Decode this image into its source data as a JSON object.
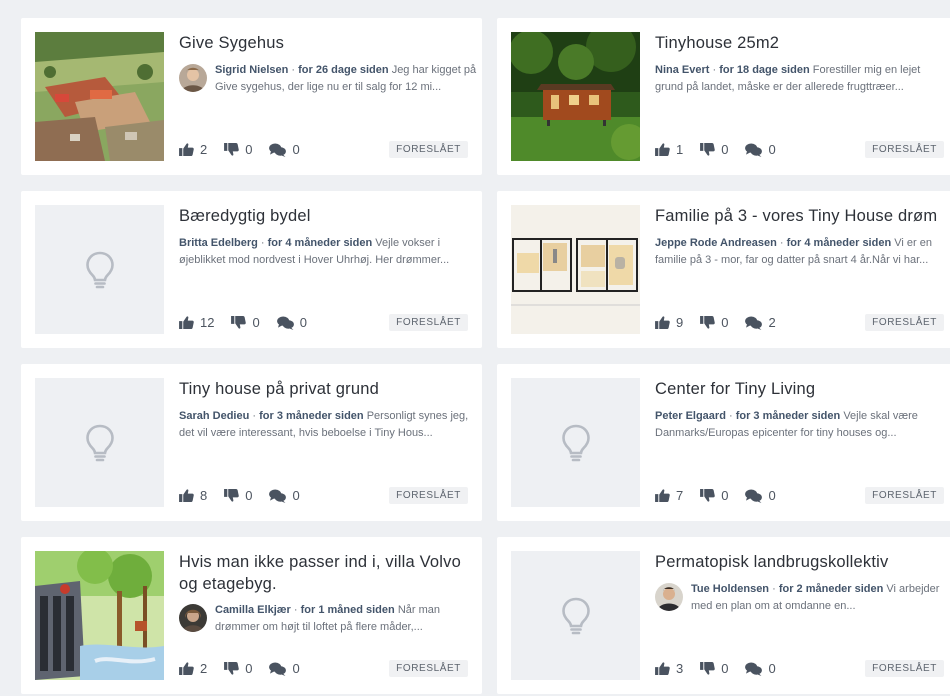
{
  "status_label": "FORESLÅET",
  "colors": {
    "background": "#eef0f3",
    "card": "#ffffff",
    "author": "#43546a",
    "badge_bg": "#f0f1f3"
  },
  "icons": {
    "like": "thumbs-up-icon",
    "dislike": "thumbs-down-icon",
    "comments": "comments-icon",
    "placeholder": "lightbulb-icon"
  },
  "ideas": [
    {
      "title": "Give Sygehus",
      "author": "Sigrid Nielsen",
      "time": "for 26 dage siden",
      "excerpt": "Jeg har kigget på Give sygehus, der lige nu er til salg for 12 mi...",
      "likes": "2",
      "dislikes": "0",
      "comments": "0"
    },
    {
      "title": "Tinyhouse 25m2",
      "author": "Nina Evert",
      "time": "for 18 dage siden",
      "excerpt": "Forestiller mig en lejet grund på landet, måske er der allerede frugttræer...",
      "likes": "1",
      "dislikes": "0",
      "comments": "0"
    },
    {
      "title": "Bæredygtig bydel",
      "author": "Britta Edelberg",
      "time": "for 4 måneder siden",
      "excerpt": "Vejle vokser i øjeblikket mod nordvest i Hover Uhrhøj. Her drømmer...",
      "likes": "12",
      "dislikes": "0",
      "comments": "0"
    },
    {
      "title": "Familie på 3 - vores Tiny House drøm",
      "author": "Jeppe Rode Andreasen",
      "time": "for 4 måneder siden",
      "excerpt": "Vi er en familie på 3 - mor, far og datter på snart 4 år.Når vi har...",
      "likes": "9",
      "dislikes": "0",
      "comments": "2"
    },
    {
      "title": "Tiny house på privat grund",
      "author": "Sarah Dedieu",
      "time": "for 3 måneder siden",
      "excerpt": "Personligt synes jeg, det vil være interessant, hvis beboelse i Tiny Hous...",
      "likes": "8",
      "dislikes": "0",
      "comments": "0"
    },
    {
      "title": "Center for Tiny Living",
      "author": "Peter Elgaard",
      "time": "for 3 måneder siden",
      "excerpt": "Vejle skal være Danmarks/Europas epicenter for tiny houses og...",
      "likes": "7",
      "dislikes": "0",
      "comments": "0"
    },
    {
      "title": "Hvis man ikke passer ind i, villa Volvo og etagebyg.",
      "author": "Camilla Elkjær",
      "time": "for 1 måned siden",
      "excerpt": "Når man drømmer om højt til loftet på flere måder,...",
      "likes": "2",
      "dislikes": "0",
      "comments": "0"
    },
    {
      "title": "Permatopisk landbrugskollektiv",
      "author": "Tue Holdensen",
      "time": "for 2 måneder siden",
      "excerpt": "Vi arbejder med en plan om at omdanne en...",
      "likes": "3",
      "dislikes": "0",
      "comments": "0"
    }
  ]
}
